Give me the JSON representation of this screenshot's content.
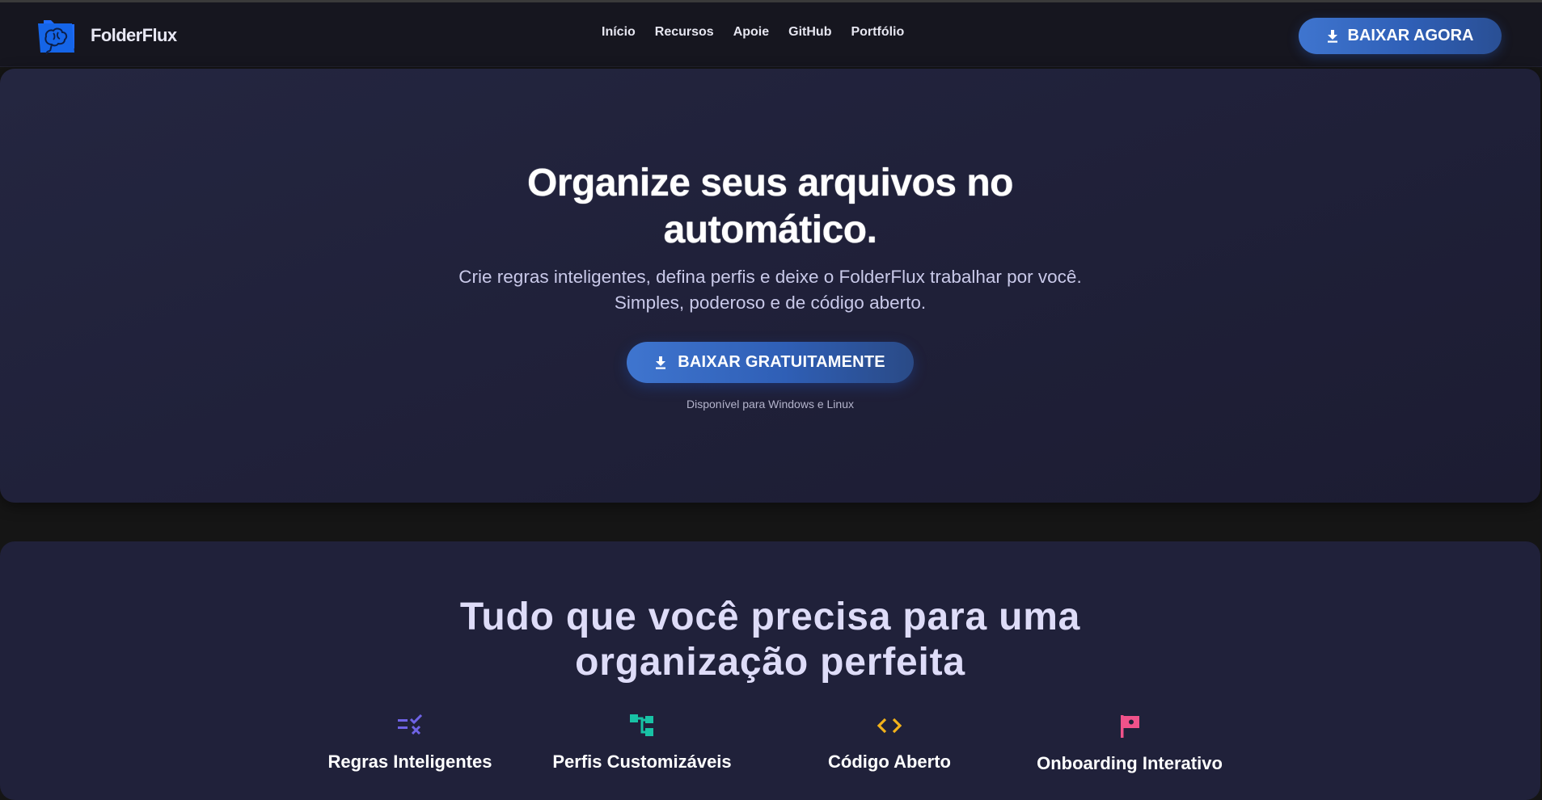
{
  "brand": {
    "name": "FolderFlux",
    "logo_icon": "folder-brain-logo",
    "logo_color": "#1f6cff"
  },
  "nav": {
    "links": [
      "Início",
      "Recursos",
      "Apoie",
      "GitHub",
      "Portfólio"
    ],
    "cta_label": "BAIXAR AGORA",
    "cta_icon": "download-icon"
  },
  "hero": {
    "title": "Organize seus arquivos no automático.",
    "subtitle_line1": "Crie regras inteligentes, defina perfis e deixe o FolderFlux trabalhar por você.",
    "subtitle_line2": "Simples, poderoso e de código aberto.",
    "cta_label": "BAIXAR GRATUITAMENTE",
    "cta_icon": "download-icon",
    "note": "Disponível para Windows e Linux"
  },
  "features": {
    "title": "Tudo que você precisa para uma organização perfeita",
    "items": [
      {
        "label": "Regras Inteligentes",
        "icon": "rules-checklist-icon",
        "color": "#6f63e6"
      },
      {
        "label": "Perfis Customizáveis",
        "icon": "tree-structure-icon",
        "color": "#18c2a5"
      },
      {
        "label": "Código Aberto",
        "icon": "code-brackets-icon",
        "color": "#f2b21a"
      },
      {
        "label": "Onboarding Interativo",
        "icon": "flag-icon",
        "color": "#f0528a"
      }
    ]
  },
  "colors": {
    "accent": "#3a6cc8",
    "hero_bg": "#22233c",
    "page_bg": "#151515"
  }
}
